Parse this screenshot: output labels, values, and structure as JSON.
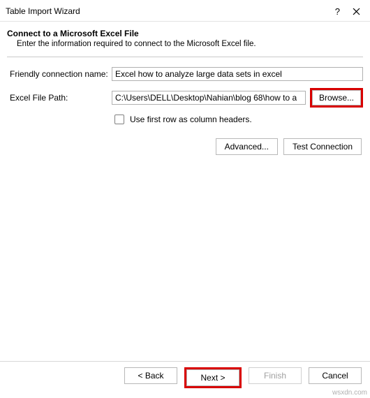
{
  "titlebar": {
    "title": "Table Import Wizard",
    "help": "?",
    "close": "×"
  },
  "header": {
    "heading": "Connect to a Microsoft Excel File",
    "subtext": "Enter the information required to connect to the Microsoft Excel file."
  },
  "form": {
    "friendly_label": "Friendly connection name:",
    "friendly_value": "Excel how to analyze large data sets in excel",
    "path_label": "Excel File Path:",
    "path_value": "C:\\Users\\DELL\\Desktop\\Nahian\\blog 68\\how to a",
    "browse_label": "Browse...",
    "first_row_label": "Use first row as column headers."
  },
  "buttons": {
    "advanced": "Advanced...",
    "test_connection": "Test Connection"
  },
  "footer": {
    "back": "< Back",
    "next": "Next >",
    "finish": "Finish",
    "cancel": "Cancel"
  },
  "watermark": "wsxdn.com"
}
